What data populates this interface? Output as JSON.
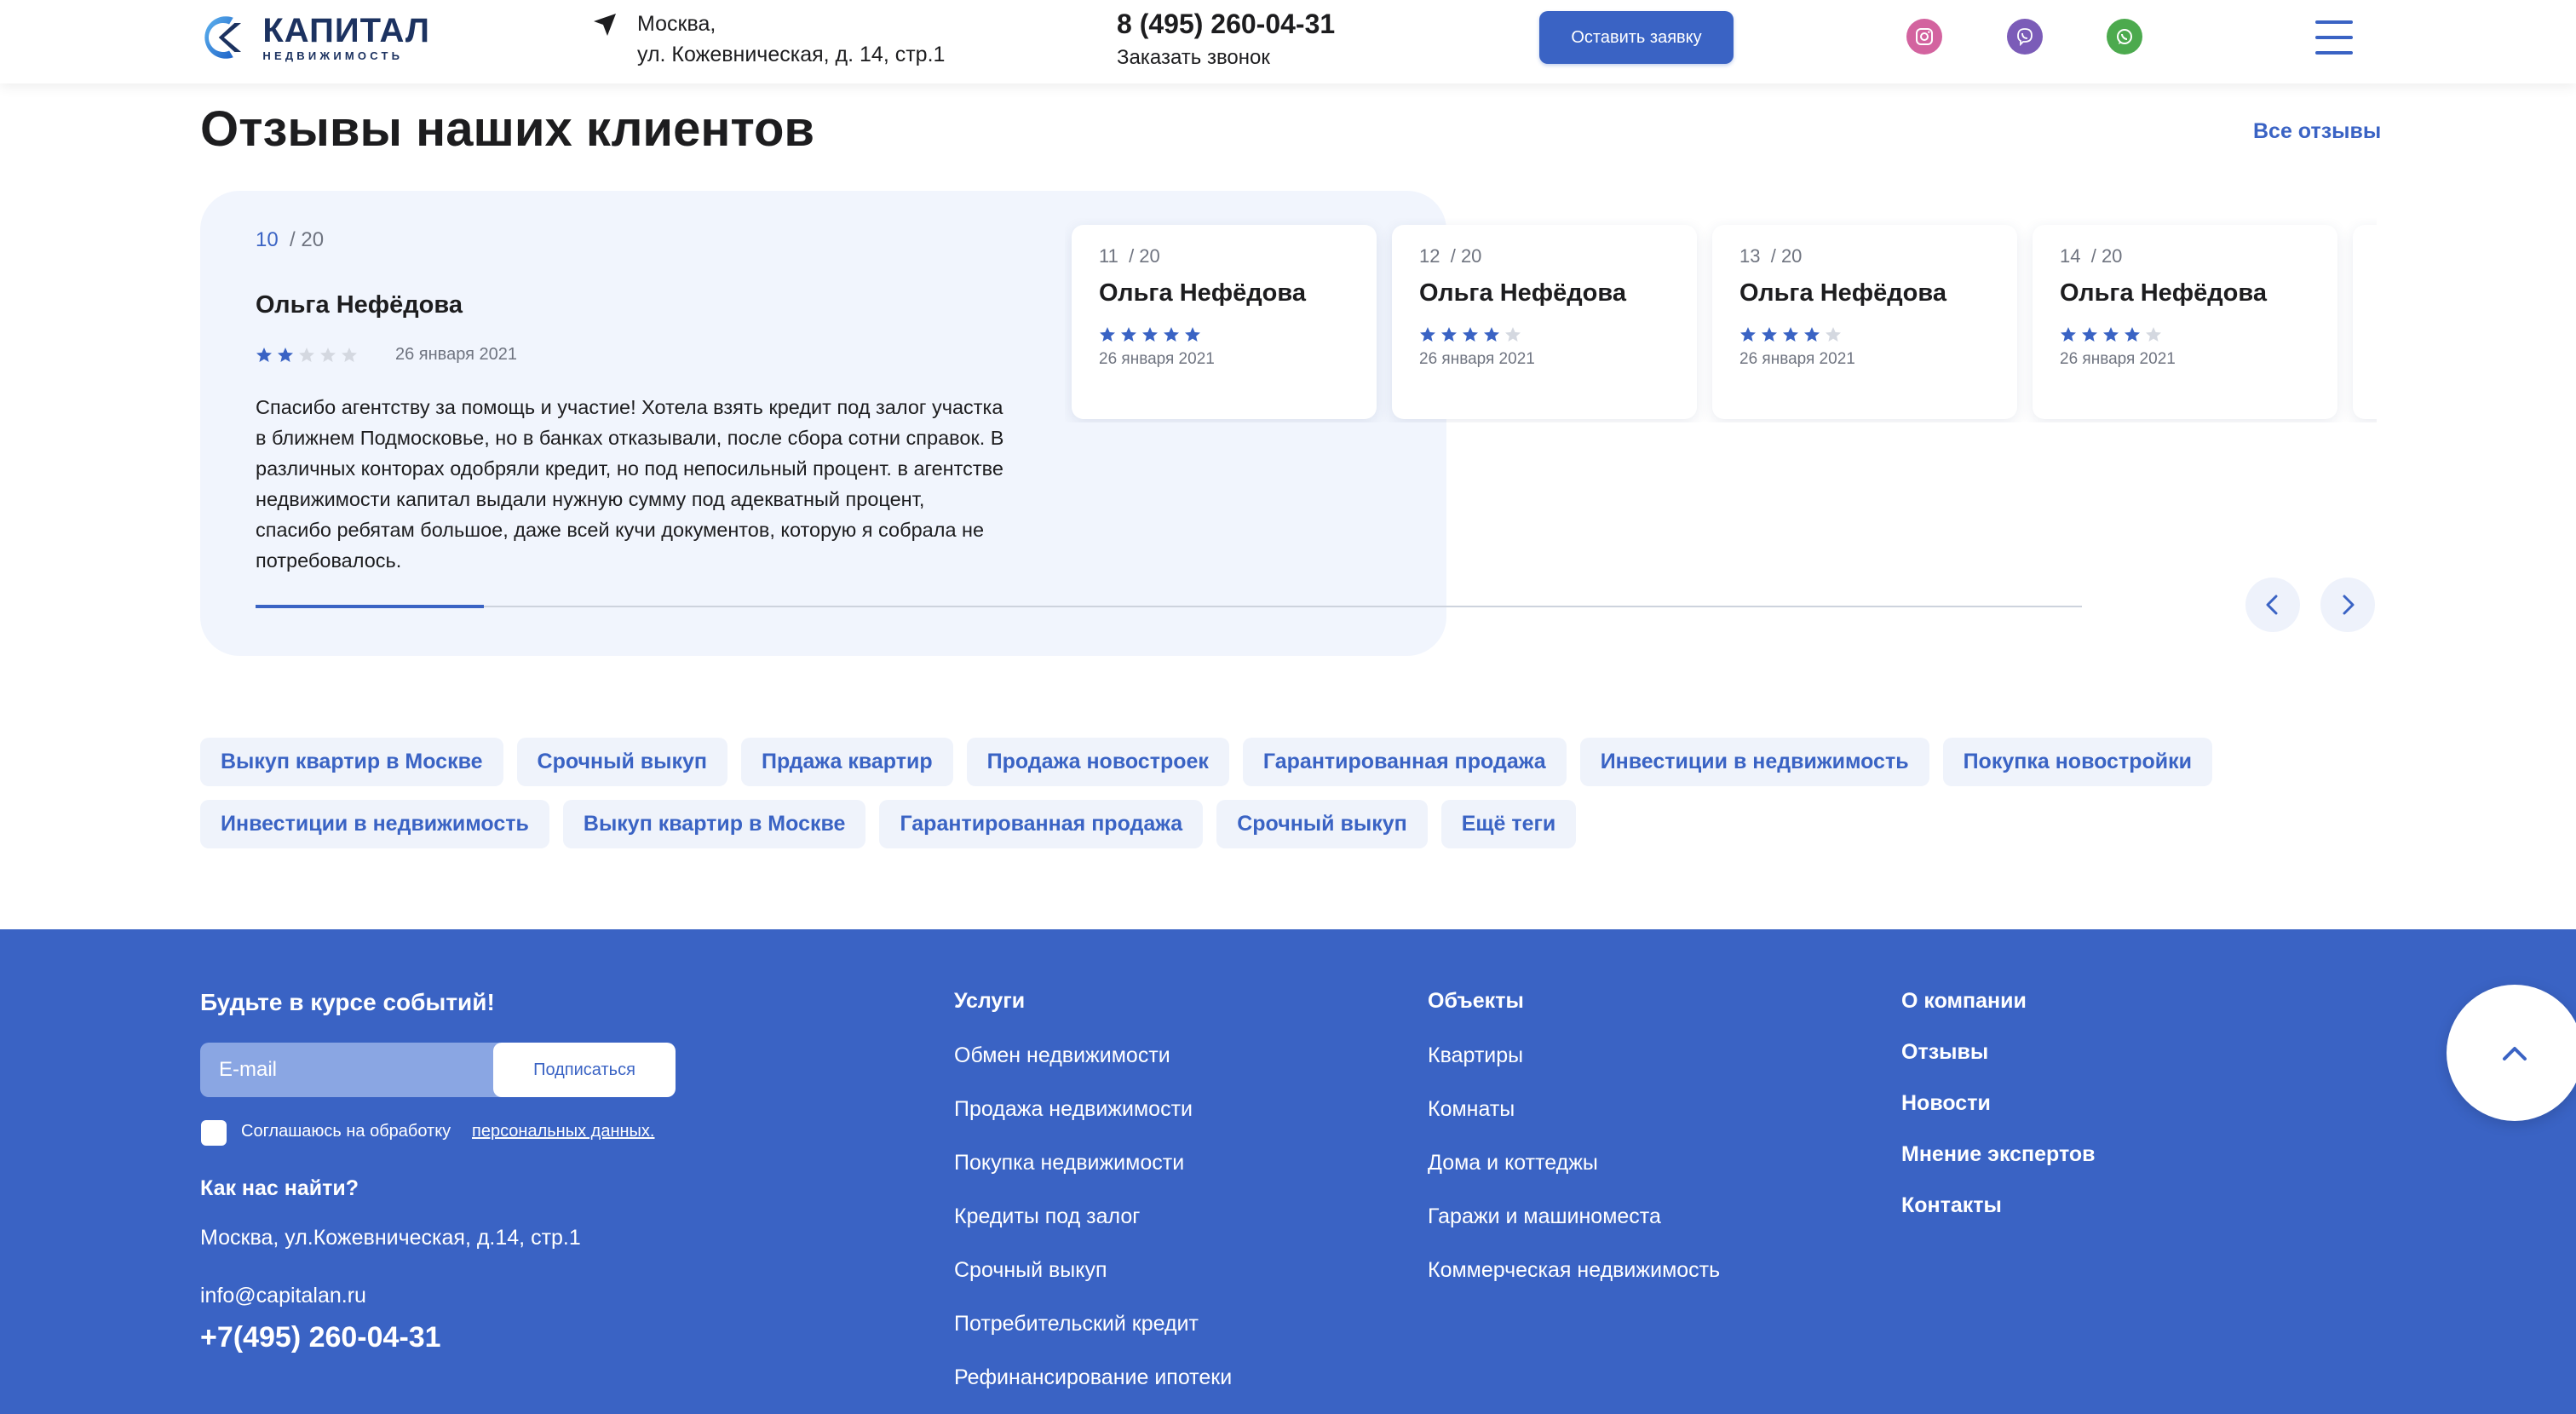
{
  "header": {
    "logo_title": "КАПИТАЛ",
    "logo_sub": "НЕДВИЖИМОСТЬ",
    "address_line1": "Москва,",
    "address_line2": "ул. Кожевническая, д. 14, стр.1",
    "phone": "8 (495) 260-04-31",
    "callback": "Заказать звонок",
    "request_button": "Оставить заявку",
    "social_icons": [
      "instagram-icon",
      "viber-icon",
      "whatsapp-icon"
    ]
  },
  "reviews": {
    "title": "Отзывы наших клиентов",
    "all_link": "Все отзывы",
    "progress": 0.125,
    "active": {
      "current": "10",
      "total": "/ 20",
      "name": "Ольга Нефёдова",
      "rating": 2,
      "date": "26 января 2021",
      "text": "Спасибо агентству за помощь и участие! Хотела взять кредит под залог участка в ближнем Подмосковье, но в банках отказывали, после сбора сотни справок. В различных конторах одобряли кредит, но под непосильный процент. в агентстве недвижимости капитал выдали нужную сумму под адекватный процент, спасибо ребятам большое, даже всей кучи документов, которую я собрала не потребовалось."
    },
    "cards": [
      {
        "current": "11",
        "total": "/ 20",
        "name": "Ольга Нефёдова",
        "rating": 5,
        "date": "26 января 2021"
      },
      {
        "current": "12",
        "total": "/ 20",
        "name": "Ольга Нефёдова",
        "rating": 4,
        "date": "26 января 2021"
      },
      {
        "current": "13",
        "total": "/ 20",
        "name": "Ольга Нефёдова",
        "rating": 4,
        "date": "26 января 2021"
      },
      {
        "current": "14",
        "total": "/ 20",
        "name": "Ольга Нефёдова",
        "rating": 4,
        "date": "26 января 2021"
      }
    ]
  },
  "tags": [
    "Выкуп квартир в Москве",
    "Срочный выкуп",
    "Прдажа квартир",
    "Продажа новостроек",
    "Гарантированная продажа",
    "Инвестиции в недвижимость",
    "Покупка новостройки",
    "Инвестиции в недвижимость",
    "Выкуп квартир в Москве",
    "Гарантированная продажа",
    "Срочный выкуп",
    "Ещё теги"
  ],
  "footer": {
    "subscribe_title": "Будьте в курсе событий!",
    "email_placeholder": "E-mail",
    "subscribe_button": "Подписаться",
    "consent_text": "Соглашаюсь на обработку",
    "consent_link": "персональных данных.",
    "find_title": "Как нас найти?",
    "address": "Москва, ул.Кожевническая, д.14, стр.1",
    "email": "info@capitalan.ru",
    "phone": "+7(495) 260-04-31",
    "services": {
      "title": "Услуги",
      "items": [
        "Обмен недвижимости",
        "Продажа недвижимости",
        "Покупка недвижимости",
        "Кредиты под залог",
        "Срочный выкуп",
        "Потребительский кредит",
        "Рефинансирование ипотеки"
      ]
    },
    "objects": {
      "title": "Объекты",
      "items": [
        "Квартиры",
        "Комнаты",
        "Дома и коттеджы",
        "Гаражи и машиноместа",
        "Коммерческая недвижимость"
      ]
    },
    "company": {
      "items": [
        "О компании",
        "Отзывы",
        "Новости",
        "Мнение экспертов",
        "Контакты"
      ]
    }
  },
  "colors": {
    "accent": "#3a63c4",
    "star_active": "#3a63c4",
    "star_inactive": "#d4d8e0",
    "panel_bg": "#f1f5fd"
  }
}
